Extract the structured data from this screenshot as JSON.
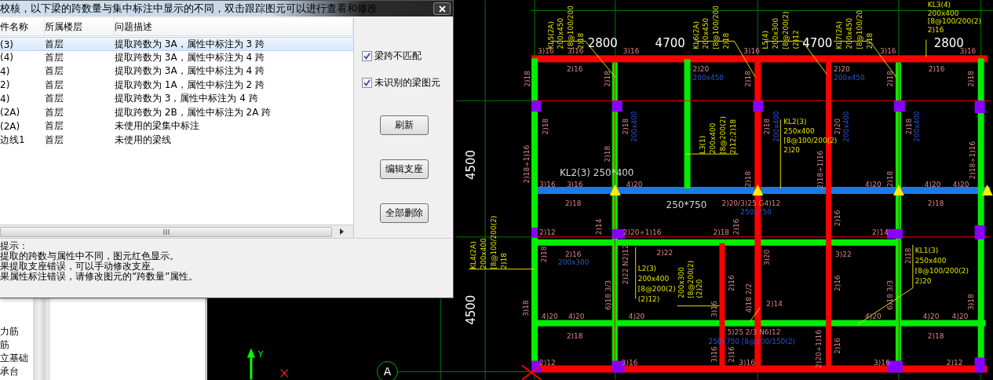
{
  "dialog": {
    "title": "校核，以下梁的跨数量与集中标注中显示的不同，双击跟踪图元可以进行查看和修改",
    "table": {
      "columns": [
        "件名称",
        "所属楼层",
        "问题描述"
      ],
      "rows": [
        {
          "name": "(3)",
          "floor": "首层",
          "problem": "提取跨数为 3A，属性中标注为 3 跨",
          "selected": true
        },
        {
          "name": "(4)",
          "floor": "首层",
          "problem": "提取跨数为 3A，属性中标注为 4 跨",
          "selected": false
        },
        {
          "name": "4)",
          "floor": "首层",
          "problem": "提取跨数为 3A，属性中标注为 4 跨",
          "selected": false
        },
        {
          "name": "2)",
          "floor": "首层",
          "problem": "提取跨数为 1A，属性中标注为 2 跨",
          "selected": false
        },
        {
          "name": "4)",
          "floor": "首层",
          "problem": "提取跨数为 3，属性中标注为 4 跨",
          "selected": false
        },
        {
          "name": "(2A)",
          "floor": "首层",
          "problem": "提取跨数为 2B，属性中标注为 2A 跨",
          "selected": false
        },
        {
          "name": "(2A)",
          "floor": "首层",
          "problem": "未使用的梁集中标注",
          "selected": false
        },
        {
          "name": "边线1",
          "floor": "首层",
          "problem": "未使用的梁线",
          "selected": false
        }
      ]
    },
    "options": [
      {
        "label": "梁跨不匹配",
        "checked": true
      },
      {
        "label": "未识别的梁图元",
        "checked": true
      }
    ],
    "buttons": [
      "刷新",
      "编辑支座",
      "全部删除"
    ],
    "hints": [
      "提示：",
      "提取的跨数与属性中不同，图元红色显示。",
      "果提取支座错误，可以手动修改支座。",
      "果属性标注错误，请修改图元的“跨数量”属性。"
    ]
  },
  "tree": {
    "items": [
      "力筋",
      "筋",
      "立基础",
      "承台"
    ]
  },
  "drawing": {
    "axis_label": "Y",
    "grid_label": "A",
    "labels": [
      {
        "text": "2800",
        "kind": "dim"
      },
      {
        "text": "4700",
        "kind": "dim"
      },
      {
        "text": "4700",
        "kind": "dim"
      },
      {
        "text": "2800",
        "kind": "dim"
      },
      {
        "text": "4500",
        "kind": "dim"
      },
      {
        "text": "4500",
        "kind": "dim"
      },
      {
        "text": "KL2(3) 250*400",
        "kind": "tag"
      },
      {
        "text": "250*750",
        "kind": "tag"
      },
      {
        "text": "KL5(2A)",
        "kind": "note"
      },
      {
        "text": "200x450",
        "kind": "note"
      },
      {
        "text": "[8@100/200",
        "kind": "note"
      },
      {
        "text": "2)18",
        "kind": "note"
      },
      {
        "text": "KL6(2A)",
        "kind": "note"
      },
      {
        "text": "200x450",
        "kind": "note"
      },
      {
        "text": "[8@100/200",
        "kind": "note"
      },
      {
        "text": "2)18",
        "kind": "note"
      },
      {
        "text": "L5(4)",
        "kind": "note"
      },
      {
        "text": "200x300",
        "kind": "note"
      },
      {
        "text": "[8@200(2)",
        "kind": "note"
      },
      {
        "text": "(2)12",
        "kind": "note"
      },
      {
        "text": "KL7(2A)",
        "kind": "note"
      },
      {
        "text": "200x450",
        "kind": "note"
      },
      {
        "text": "[8@100/20",
        "kind": "note"
      },
      {
        "text": "2)18",
        "kind": "note"
      },
      {
        "text": "KL3(4)",
        "kind": "note"
      },
      {
        "text": "200x400",
        "kind": "note"
      },
      {
        "text": "[8@100/200(2)",
        "kind": "note"
      },
      {
        "text": "2)16",
        "kind": "note"
      },
      {
        "text": "L3(1)",
        "kind": "note"
      },
      {
        "text": "200x400",
        "kind": "note"
      },
      {
        "text": "[8@200(2)",
        "kind": "note"
      },
      {
        "text": "2)12;2)18",
        "kind": "note"
      },
      {
        "text": "KL2(3)",
        "kind": "note"
      },
      {
        "text": "250x400",
        "kind": "note"
      },
      {
        "text": "[8@100/200(2)",
        "kind": "note"
      },
      {
        "text": "2)20",
        "kind": "note"
      },
      {
        "text": "KL4(2A)",
        "kind": "note"
      },
      {
        "text": "200x400",
        "kind": "note"
      },
      {
        "text": "[8@100/200(2)",
        "kind": "note"
      },
      {
        "text": "2)18",
        "kind": "note"
      },
      {
        "text": "L2(3)",
        "kind": "note"
      },
      {
        "text": "200x400",
        "kind": "note"
      },
      {
        "text": "[8@200(2)",
        "kind": "note"
      },
      {
        "text": "(2)12)",
        "kind": "note"
      },
      {
        "text": "200x300",
        "kind": "note"
      },
      {
        "text": "[8@200(2)",
        "kind": "note"
      },
      {
        "text": "(2)20",
        "kind": "note"
      },
      {
        "text": "KL1(3)",
        "kind": "note"
      },
      {
        "text": "250x400",
        "kind": "note"
      },
      {
        "text": "[8@100/200(2)",
        "kind": "note"
      },
      {
        "text": "2)20",
        "kind": "note"
      },
      {
        "text": "3)16",
        "kind": "rebar"
      },
      {
        "text": "3)16",
        "kind": "rebar"
      },
      {
        "text": "3)16",
        "kind": "rebar"
      },
      {
        "text": "3)16",
        "kind": "rebar"
      },
      {
        "text": "3)16",
        "kind": "rebar"
      },
      {
        "text": "3)16",
        "kind": "rebar"
      },
      {
        "text": "2)16",
        "kind": "rebar"
      },
      {
        "text": "2)20",
        "kind": "rebar"
      },
      {
        "text": "2)20",
        "kind": "rebar"
      },
      {
        "text": "2)16",
        "kind": "rebar"
      },
      {
        "text": "3)16",
        "kind": "rebar"
      },
      {
        "text": "3)16",
        "kind": "rebar"
      },
      {
        "text": "4)20",
        "kind": "rebar"
      },
      {
        "text": "4)20",
        "kind": "rebar"
      },
      {
        "text": "4)20",
        "kind": "rebar"
      },
      {
        "text": "4)20",
        "kind": "rebar"
      },
      {
        "text": "2)18",
        "kind": "rebar"
      },
      {
        "text": "2)20/3)25 G4)12",
        "kind": "rebar"
      },
      {
        "text": "2)18",
        "kind": "rebar"
      },
      {
        "text": "2)12",
        "kind": "rebar"
      },
      {
        "text": "2)20+1)16",
        "kind": "rebar"
      },
      {
        "text": "2)18",
        "kind": "rebar"
      },
      {
        "text": "2)14",
        "kind": "rebar"
      },
      {
        "text": "2)16",
        "kind": "rebar"
      },
      {
        "text": "2)22",
        "kind": "rebar"
      },
      {
        "text": "3)22",
        "kind": "rebar"
      },
      {
        "text": "2)14",
        "kind": "rebar"
      },
      {
        "text": "4)20",
        "kind": "rebar"
      },
      {
        "text": "4)20",
        "kind": "rebar"
      },
      {
        "text": "4)20",
        "kind": "rebar"
      },
      {
        "text": "4)20",
        "kind": "rebar"
      },
      {
        "text": "4)20",
        "kind": "rebar"
      },
      {
        "text": "4)20",
        "kind": "rebar"
      },
      {
        "text": "2)18",
        "kind": "rebar"
      },
      {
        "text": "5)25 2/3 N6)12",
        "kind": "rebar"
      },
      {
        "text": "2)18",
        "kind": "rebar"
      },
      {
        "text": "2)12",
        "kind": "rebar"
      },
      {
        "text": "3)16",
        "kind": "rebar"
      },
      {
        "text": "3)16",
        "kind": "rebar"
      },
      {
        "text": "3)16",
        "kind": "rebar"
      },
      {
        "text": "2)12",
        "kind": "rebar"
      },
      {
        "text": "2)18",
        "kind": "rebar"
      },
      {
        "text": "2)18",
        "kind": "rebar"
      },
      {
        "text": "2)18",
        "kind": "rebar"
      },
      {
        "text": "2)18",
        "kind": "rebar"
      },
      {
        "text": "2)18",
        "kind": "rebar"
      },
      {
        "text": "2)18",
        "kind": "rebar"
      },
      {
        "text": "2)18",
        "kind": "rebar"
      },
      {
        "text": "2)18",
        "kind": "rebar"
      },
      {
        "text": "2)20",
        "kind": "rebar"
      },
      {
        "text": "2)18",
        "kind": "rebar"
      },
      {
        "text": "2)18+1)16",
        "kind": "rebar"
      },
      {
        "text": "2)18+1)16",
        "kind": "rebar"
      },
      {
        "text": "2)18+1)16",
        "kind": "rebar"
      },
      {
        "text": "2)18",
        "kind": "rebar"
      },
      {
        "text": "2)18",
        "kind": "rebar"
      },
      {
        "text": "2)18",
        "kind": "rebar"
      },
      {
        "text": "2)16",
        "kind": "rebar"
      },
      {
        "text": "2)14",
        "kind": "rebar"
      },
      {
        "text": "2)16",
        "kind": "rebar"
      },
      {
        "text": "2)18",
        "kind": "rebar"
      },
      {
        "text": "2)22 N2)12",
        "kind": "rebar"
      },
      {
        "text": "3)20",
        "kind": "rebar"
      },
      {
        "text": "2)18",
        "kind": "rebar"
      },
      {
        "text": "2)16",
        "kind": "rebar"
      },
      {
        "text": "2)16",
        "kind": "rebar"
      },
      {
        "text": "6)18 3/3",
        "kind": "rebar"
      },
      {
        "text": "3)16",
        "kind": "rebar"
      },
      {
        "text": "4)18 2/2",
        "kind": "rebar"
      },
      {
        "text": "6)18 3/3",
        "kind": "rebar"
      },
      {
        "text": "3)18",
        "kind": "rebar"
      },
      {
        "text": "3)18",
        "kind": "rebar"
      },
      {
        "text": "3)16",
        "kind": "rebar"
      },
      {
        "text": "2)16",
        "kind": "rebar"
      },
      {
        "text": "2)20+1)16",
        "kind": "rebar"
      },
      {
        "text": "2)16",
        "kind": "rebar"
      },
      {
        "text": "200x450",
        "kind": "size"
      },
      {
        "text": "200x450",
        "kind": "size"
      },
      {
        "text": "200x400",
        "kind": "size"
      },
      {
        "text": "200x400",
        "kind": "size"
      },
      {
        "text": "200x400",
        "kind": "size"
      },
      {
        "text": "200x400",
        "kind": "size"
      },
      {
        "text": "250x750",
        "kind": "size"
      },
      {
        "text": "200x300",
        "kind": "size"
      },
      {
        "text": "250x750 [8@100/150(2)",
        "kind": "size"
      }
    ]
  }
}
